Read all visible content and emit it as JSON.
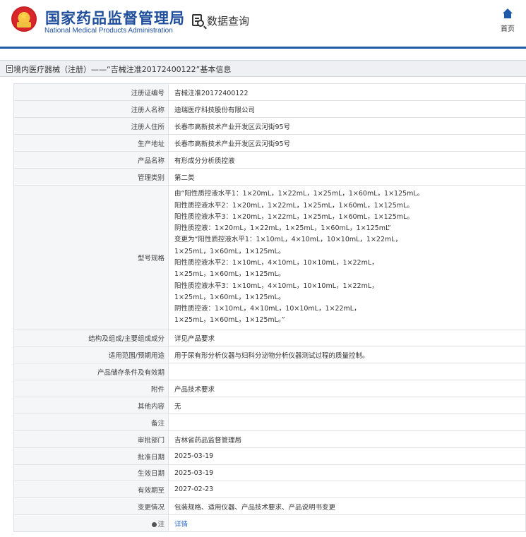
{
  "header": {
    "site_title": "国家药品监督管理局",
    "site_subtitle": "National Medical Products Administration",
    "query_label": "数据查询",
    "query_icon": "document-search-icon",
    "home_label": "首页",
    "home_icon": "home-icon",
    "accent_color": "#1f5aa8"
  },
  "breadcrumb": {
    "icon": "document-icon",
    "text": "境内医疗器械（注册）——“吉械注准20172400122”基本信息"
  },
  "record": {
    "reg_no": {
      "label": "注册证编号",
      "value": "吉械注准20172400122"
    },
    "registrant": {
      "label": "注册人名称",
      "value": "迪瑞医疗科技股份有限公司"
    },
    "registrant_address": {
      "label": "注册人住所",
      "value": "长春市高新技术产业开发区云河街95号"
    },
    "production_address": {
      "label": "生产地址",
      "value": "长春市高新技术产业开发区云河街95号"
    },
    "product_name": {
      "label": "产品名称",
      "value": "有形成分分析质控液"
    },
    "management_class": {
      "label": "管理类别",
      "value": "第二类"
    },
    "model_spec": {
      "label": "型号规格",
      "lines": [
        "由“阳性质控液水平1：1×20mL，1×22mL，1×25mL，1×60mL，1×125mL。",
        "阳性质控液水平2：1×20mL，1×22mL，1×25mL，1×60mL，1×125mL。",
        "阳性质控液水平3：1×20mL，1×22mL，1×25mL，1×60mL，1×125mL。",
        "阴性质控液：1×20mL，1×22mL，1×25mL，1×60mL，1×125mL”",
        "变更为“阳性质控液水平1：1×10mL，4×10mL，10×10mL，1×22mL，",
        "1×25mL，1×60mL，1×125mL。",
        "阳性质控液水平2：1×10mL，4×10mL，10×10mL，1×22mL，",
        "1×25mL，1×60mL，1×125mL。",
        "阳性质控液水平3：1×10mL，4×10mL，10×10mL，1×22mL，",
        "1×25mL，1×60mL，1×125mL。",
        "阴性质控液：1×10mL，4×10mL，10×10mL，1×22mL，",
        "1×25mL，1×60mL，1×125mL。”"
      ]
    },
    "structure": {
      "label": "结构及组成/主要组成成分",
      "value": "详见产品要求"
    },
    "scope": {
      "label": "适用范围/预期用途",
      "value": "用于尿有形分析仪器与妇科分泌物分析仪器测试过程的质量控制。"
    },
    "storage": {
      "label": "产品储存条件及有效期",
      "value": ""
    },
    "attachment": {
      "label": "附件",
      "value": "产品技术要求"
    },
    "other": {
      "label": "其他内容",
      "value": "无"
    },
    "remark": {
      "label": "备注",
      "value": ""
    },
    "approval_dept": {
      "label": "审批部门",
      "value": "吉林省药品监督管理局"
    },
    "approval_date": {
      "label": "批准日期",
      "value": "2025-03-19"
    },
    "effective_date": {
      "label": "生效日期",
      "value": "2025-03-19"
    },
    "expiry_date": {
      "label": "有效期至",
      "value": "2027-02-23"
    },
    "change": {
      "label": "变更情况",
      "value": "包装规格、适用仪器、产品技术要求、产品说明书变更"
    },
    "note": {
      "label": "注",
      "icon": "tip-icon",
      "link_text": "详情",
      "link_color": "#2a6ac7"
    }
  }
}
